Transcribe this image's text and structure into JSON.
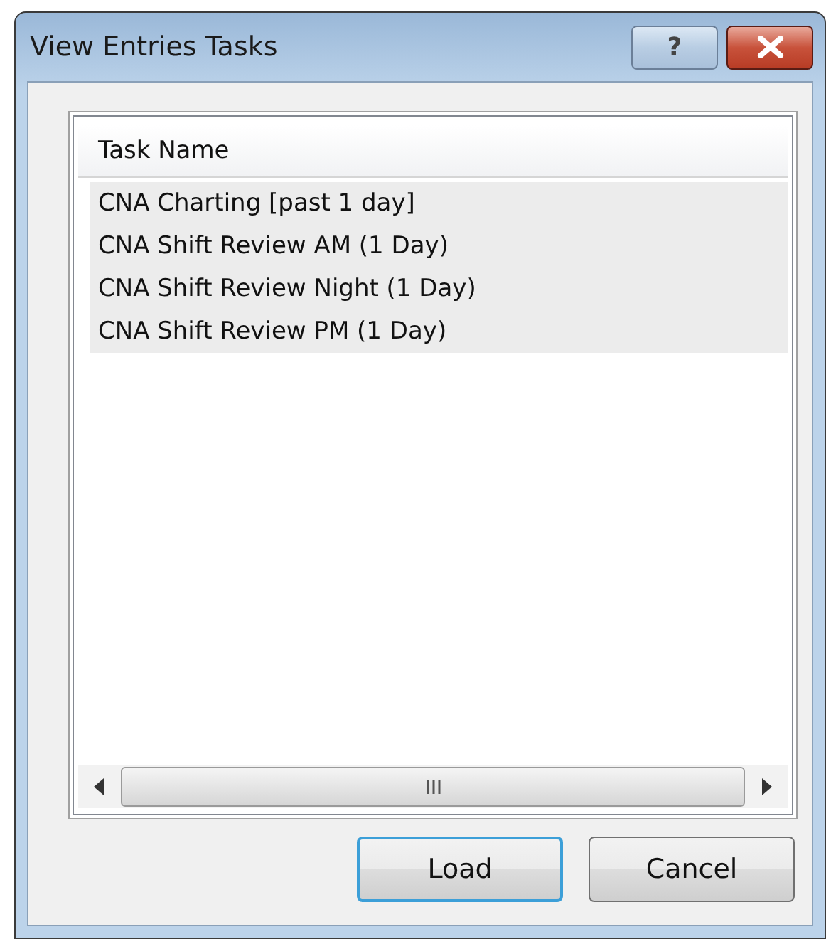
{
  "window": {
    "title": "View Entries Tasks",
    "help_button": "?"
  },
  "list": {
    "columns": [
      "Task Name"
    ],
    "rows": [
      {
        "label": "CNA Charting [past 1 day]",
        "selected": true
      },
      {
        "label": "CNA Shift Review AM (1 Day)",
        "selected": true
      },
      {
        "label": "CNA Shift Review Night (1 Day)",
        "selected": true
      },
      {
        "label": "CNA Shift Review PM (1 Day)",
        "selected": true
      }
    ]
  },
  "buttons": [
    {
      "label": "Load",
      "default": true
    },
    {
      "label": "Cancel",
      "default": false
    }
  ]
}
